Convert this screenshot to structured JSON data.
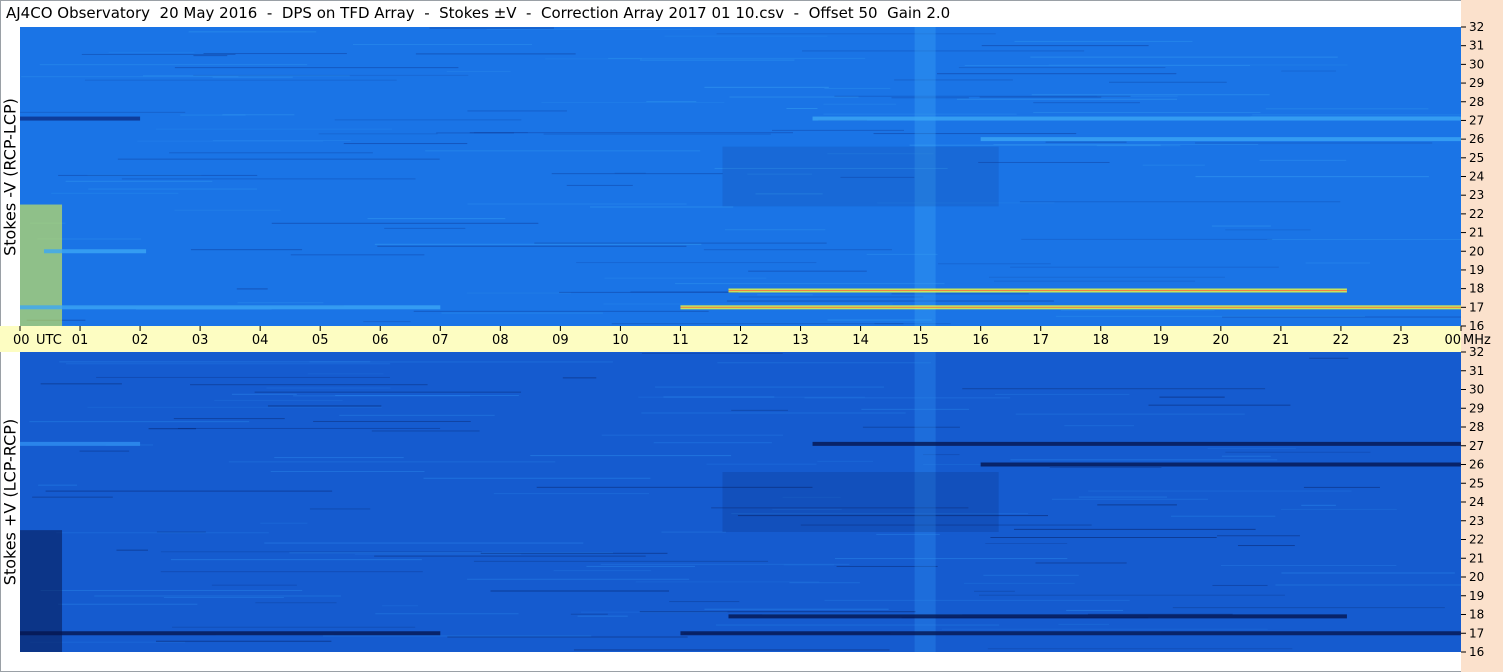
{
  "header": {
    "title": "AJ4CO Observatory  20 May 2016  -  DPS on TFD Array  -  Stokes ±V  -  Correction Array 2017 01 10.csv  -  Offset 50  Gain 2.0"
  },
  "chart_data": {
    "type": "heatmap",
    "title": "AJ4CO Observatory  20 May 2016  -  DPS on TFD Array  -  Stokes ±V  -  Correction Array 2017 01 10.csv  -  Offset 50  Gain 2.0",
    "x_axis": {
      "unit": "UTC",
      "range_hours": [
        0,
        24
      ],
      "tick_labels": [
        "00",
        "01",
        "02",
        "03",
        "04",
        "05",
        "06",
        "07",
        "08",
        "09",
        "10",
        "11",
        "12",
        "13",
        "14",
        "15",
        "16",
        "17",
        "18",
        "19",
        "20",
        "21",
        "22",
        "23",
        "00"
      ]
    },
    "y_axis": {
      "unit": "MHz",
      "range": [
        16,
        32
      ],
      "tick_labels": [
        "32",
        "31",
        "30",
        "29",
        "28",
        "27",
        "26",
        "25",
        "24",
        "23",
        "22",
        "21",
        "20",
        "19",
        "18",
        "17",
        "16"
      ]
    },
    "panels": [
      {
        "ylabel": "Stokes -V  (RCP-LCP)",
        "colors": {
          "base": "#1a74e6",
          "bright": "#3ba6f5",
          "dark": "#0b2f88",
          "hot": "#f1ff3c"
        },
        "features": [
          {
            "freq_mhz": 27.1,
            "start_utc": 0.0,
            "end_utc": 2.0,
            "strength": "dark"
          },
          {
            "freq_mhz": 27.1,
            "start_utc": 13.2,
            "end_utc": 24.0,
            "strength": "mixed"
          },
          {
            "freq_mhz": 26.0,
            "start_utc": 16.0,
            "end_utc": 24.0,
            "strength": "bright"
          },
          {
            "freq_mhz": 17.9,
            "start_utc": 11.8,
            "end_utc": 22.1,
            "strength": "hot"
          },
          {
            "freq_mhz": 17.0,
            "start_utc": 11.0,
            "end_utc": 24.0,
            "strength": "hot"
          },
          {
            "freq_mhz": 17.0,
            "start_utc": 0.0,
            "end_utc": 7.0,
            "strength": "bright"
          },
          {
            "freq_mhz": 20.0,
            "start_utc": 0.4,
            "end_utc": 2.1,
            "strength": "bright"
          }
        ]
      },
      {
        "ylabel": "Stokes +V  (LCP-RCP)",
        "colors": {
          "base": "#155bcf",
          "bright": "#2f8ff0",
          "dark": "#05154f",
          "hot": "#9bff7a"
        },
        "features": [
          {
            "freq_mhz": 27.1,
            "start_utc": 0.0,
            "end_utc": 2.0,
            "strength": "bright"
          },
          {
            "freq_mhz": 27.1,
            "start_utc": 13.2,
            "end_utc": 24.0,
            "strength": "dark"
          },
          {
            "freq_mhz": 26.0,
            "start_utc": 16.0,
            "end_utc": 24.0,
            "strength": "dark"
          },
          {
            "freq_mhz": 17.9,
            "start_utc": 11.8,
            "end_utc": 22.1,
            "strength": "dark"
          },
          {
            "freq_mhz": 17.0,
            "start_utc": 11.0,
            "end_utc": 24.0,
            "strength": "dark"
          },
          {
            "freq_mhz": 17.0,
            "start_utc": 0.0,
            "end_utc": 7.0,
            "strength": "dark"
          }
        ]
      }
    ],
    "axis_band_color": "#fdfdc2",
    "right_band_color": "#fbe1cc",
    "grid": false
  }
}
